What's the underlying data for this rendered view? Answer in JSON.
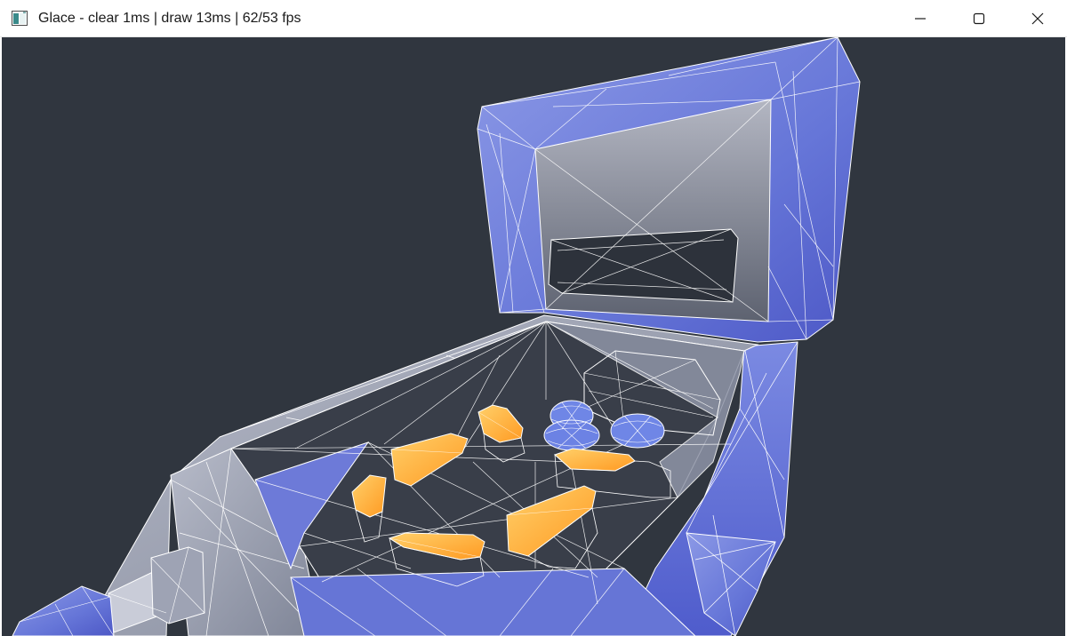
{
  "window": {
    "title": "Glace - clear 1ms | draw 13ms | 62/53 fps",
    "icon": "app-window-icon",
    "controls": {
      "minimize_icon": "minimize-icon",
      "maximize_icon": "maximize-icon",
      "close_icon": "close-icon"
    }
  },
  "scene": {
    "description_icon": "wireframe-pinball-3d-viewport",
    "colors": {
      "background": "#30363f",
      "cabinet_blue": "#6a78d8",
      "playfield_gray": "#9aa0b2",
      "flipper_orange": "#ffb03a",
      "bumper_blue": "#6f86e6",
      "wireframe": "#ffffff"
    }
  }
}
